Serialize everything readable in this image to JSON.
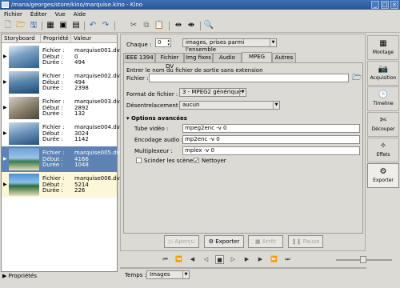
{
  "window": {
    "title": "/mana/georges/store/kino/marquise.kino - Kino"
  },
  "menu": [
    "Fichier",
    "Éditer",
    "Vue",
    "Aide"
  ],
  "storyboard": {
    "headers": [
      "Storyboard",
      "Propriété",
      "Valeur"
    ],
    "labels": [
      "Fichier :",
      "Début :",
      "Durée :"
    ],
    "rows": [
      {
        "file": "marquise001.dv",
        "start": "0",
        "duration": "494"
      },
      {
        "file": "marquise002.dv",
        "start": "494",
        "duration": "2398"
      },
      {
        "file": "marquise003.dv",
        "start": "2892",
        "duration": "132"
      },
      {
        "file": "marquise004.dv",
        "start": "3024",
        "duration": "1142"
      },
      {
        "file": "marquise005.dv",
        "start": "4166",
        "duration": "1048"
      },
      {
        "file": "marquise006.dv",
        "start": "5214",
        "duration": "226"
      }
    ],
    "footer": "Propriétés"
  },
  "export": {
    "chaque_label": "Chaque :",
    "chaque_value": "0",
    "range": "images, prises parmi l'ensemble",
    "tabs": [
      "IEEE 1394",
      "Fichier DV",
      "Img fixes",
      "Audio",
      "MPEG",
      "Autres"
    ],
    "hint": "Entrer le nom du fichier de sortie sans extension",
    "file_label": "Fichier :",
    "file_value": "",
    "format_label": "Format de fichier :",
    "format_value": "3 - MPEG2 générique",
    "deint_label": "Désentrelacement :",
    "deint_value": "aucun",
    "advanced": "Options avancées",
    "video_label": "Tube vidéo :",
    "video_value": "mpeg2enc -v 0",
    "audio_label": "Encodage audio :",
    "audio_value": "mp2enc -v 0",
    "mux_label": "Multiplexeur :",
    "mux_value": "mplex -v 0",
    "split_label": "Scinder les scènes",
    "clean_label": "Nettoyer",
    "buttons": [
      "Aperçu",
      "Exporter",
      "Arrêt",
      "Pause"
    ]
  },
  "sidebar": [
    "Montage",
    "Acquisition",
    "Timeline",
    "Découper",
    "Effets",
    "Exporter"
  ],
  "playback": {
    "temps_label": "Temps :",
    "temps_value": "Images"
  }
}
